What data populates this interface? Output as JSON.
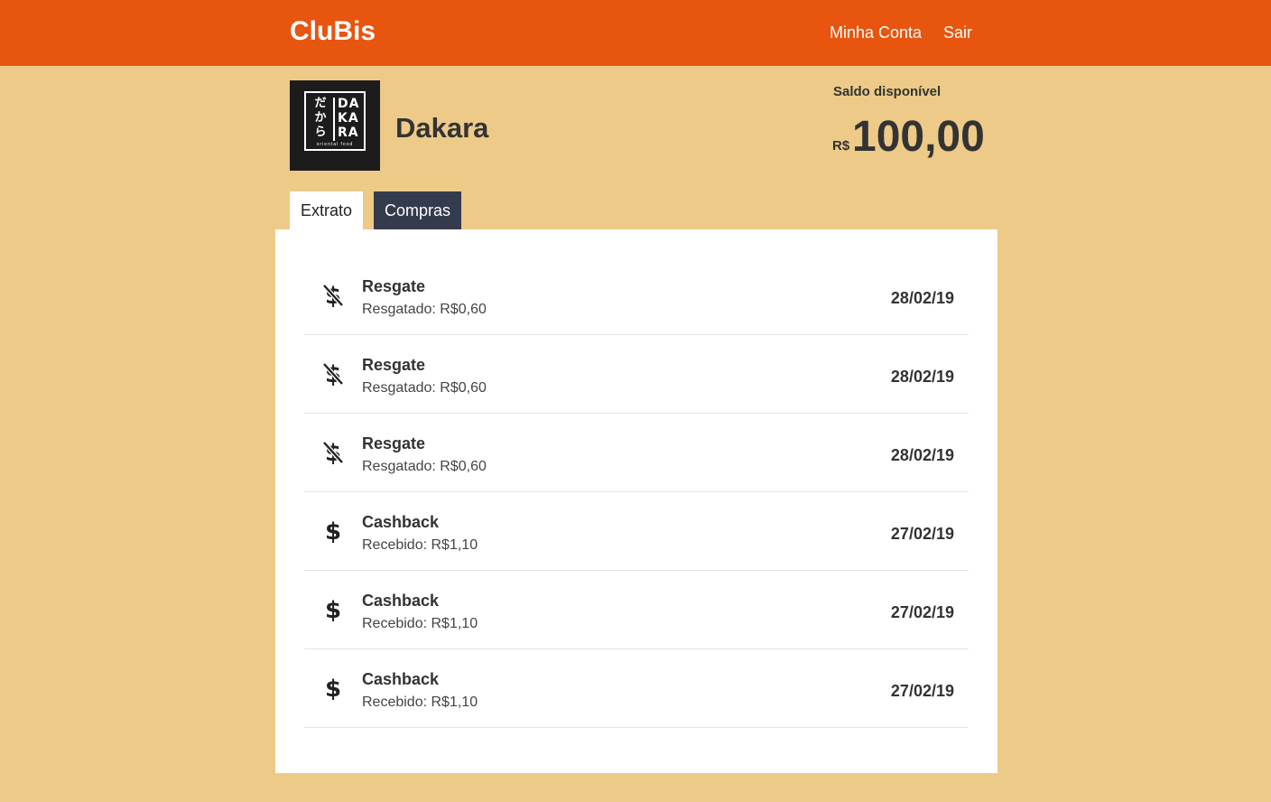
{
  "header": {
    "brand": "CluBis",
    "nav": {
      "account": "Minha Conta",
      "logout": "Sair"
    }
  },
  "store": {
    "name": "Dakara",
    "logo": {
      "jp": "だから",
      "en_lines": [
        "DA",
        "KA",
        "RA"
      ],
      "tagline": "oriental food"
    }
  },
  "balance": {
    "label": "Saldo disponível",
    "currency": "R$",
    "value": "100,00"
  },
  "tabs": [
    {
      "label": "Extrato",
      "active": true
    },
    {
      "label": "Compras",
      "active": false
    }
  ],
  "transactions": [
    {
      "icon": "dollar-off-icon",
      "title": "Resgate",
      "detail": "Resgatado: R$0,60",
      "date": "28/02/19"
    },
    {
      "icon": "dollar-off-icon",
      "title": "Resgate",
      "detail": "Resgatado: R$0,60",
      "date": "28/02/19"
    },
    {
      "icon": "dollar-off-icon",
      "title": "Resgate",
      "detail": "Resgatado: R$0,60",
      "date": "28/02/19"
    },
    {
      "icon": "dollar-icon",
      "title": "Cashback",
      "detail": "Recebido: R$1,10",
      "date": "27/02/19"
    },
    {
      "icon": "dollar-icon",
      "title": "Cashback",
      "detail": "Recebido: R$1,10",
      "date": "27/02/19"
    },
    {
      "icon": "dollar-icon",
      "title": "Cashback",
      "detail": "Recebido: R$1,10",
      "date": "27/02/19"
    }
  ],
  "colors": {
    "header": "#e8550f",
    "background": "#edca87",
    "tab_inactive": "#343b4d"
  }
}
